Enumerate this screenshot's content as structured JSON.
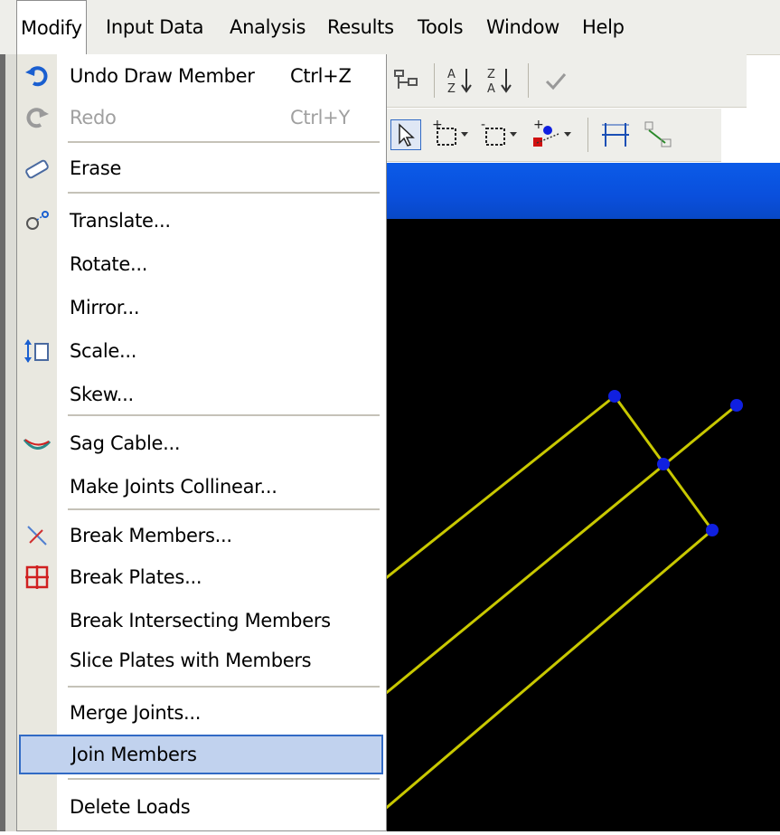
{
  "menubar": {
    "items": [
      {
        "label": "Modify"
      },
      {
        "label": "Input Data"
      },
      {
        "label": "Analysis"
      },
      {
        "label": "Results"
      },
      {
        "label": "Tools"
      },
      {
        "label": "Window"
      },
      {
        "label": "Help"
      }
    ]
  },
  "menu": {
    "undo": {
      "label": "Undo Draw Member",
      "shortcut": "Ctrl+Z"
    },
    "redo": {
      "label": "Redo",
      "shortcut": "Ctrl+Y"
    },
    "erase": {
      "label": "Erase"
    },
    "translate": {
      "label": "Translate..."
    },
    "rotate": {
      "label": "Rotate..."
    },
    "mirror": {
      "label": "Mirror..."
    },
    "scale": {
      "label": "Scale..."
    },
    "skew": {
      "label": "Skew..."
    },
    "sag_cable": {
      "label": "Sag Cable..."
    },
    "collinear": {
      "label": "Make Joints Collinear..."
    },
    "break_members": {
      "label": "Break Members..."
    },
    "break_plates": {
      "label": "Break Plates..."
    },
    "break_intersecting": {
      "label": "Break Intersecting Members"
    },
    "slice_plates": {
      "label": "Slice Plates with Members"
    },
    "merge_joints": {
      "label": "Merge Joints..."
    },
    "join_members": {
      "label": "Join Members"
    },
    "delete_loads": {
      "label": "Delete Loads"
    }
  },
  "colors": {
    "member": "#c8c800",
    "joint": "#1020e0",
    "highlight": "#c1d2ee",
    "title_band": "#0a4fdc"
  }
}
